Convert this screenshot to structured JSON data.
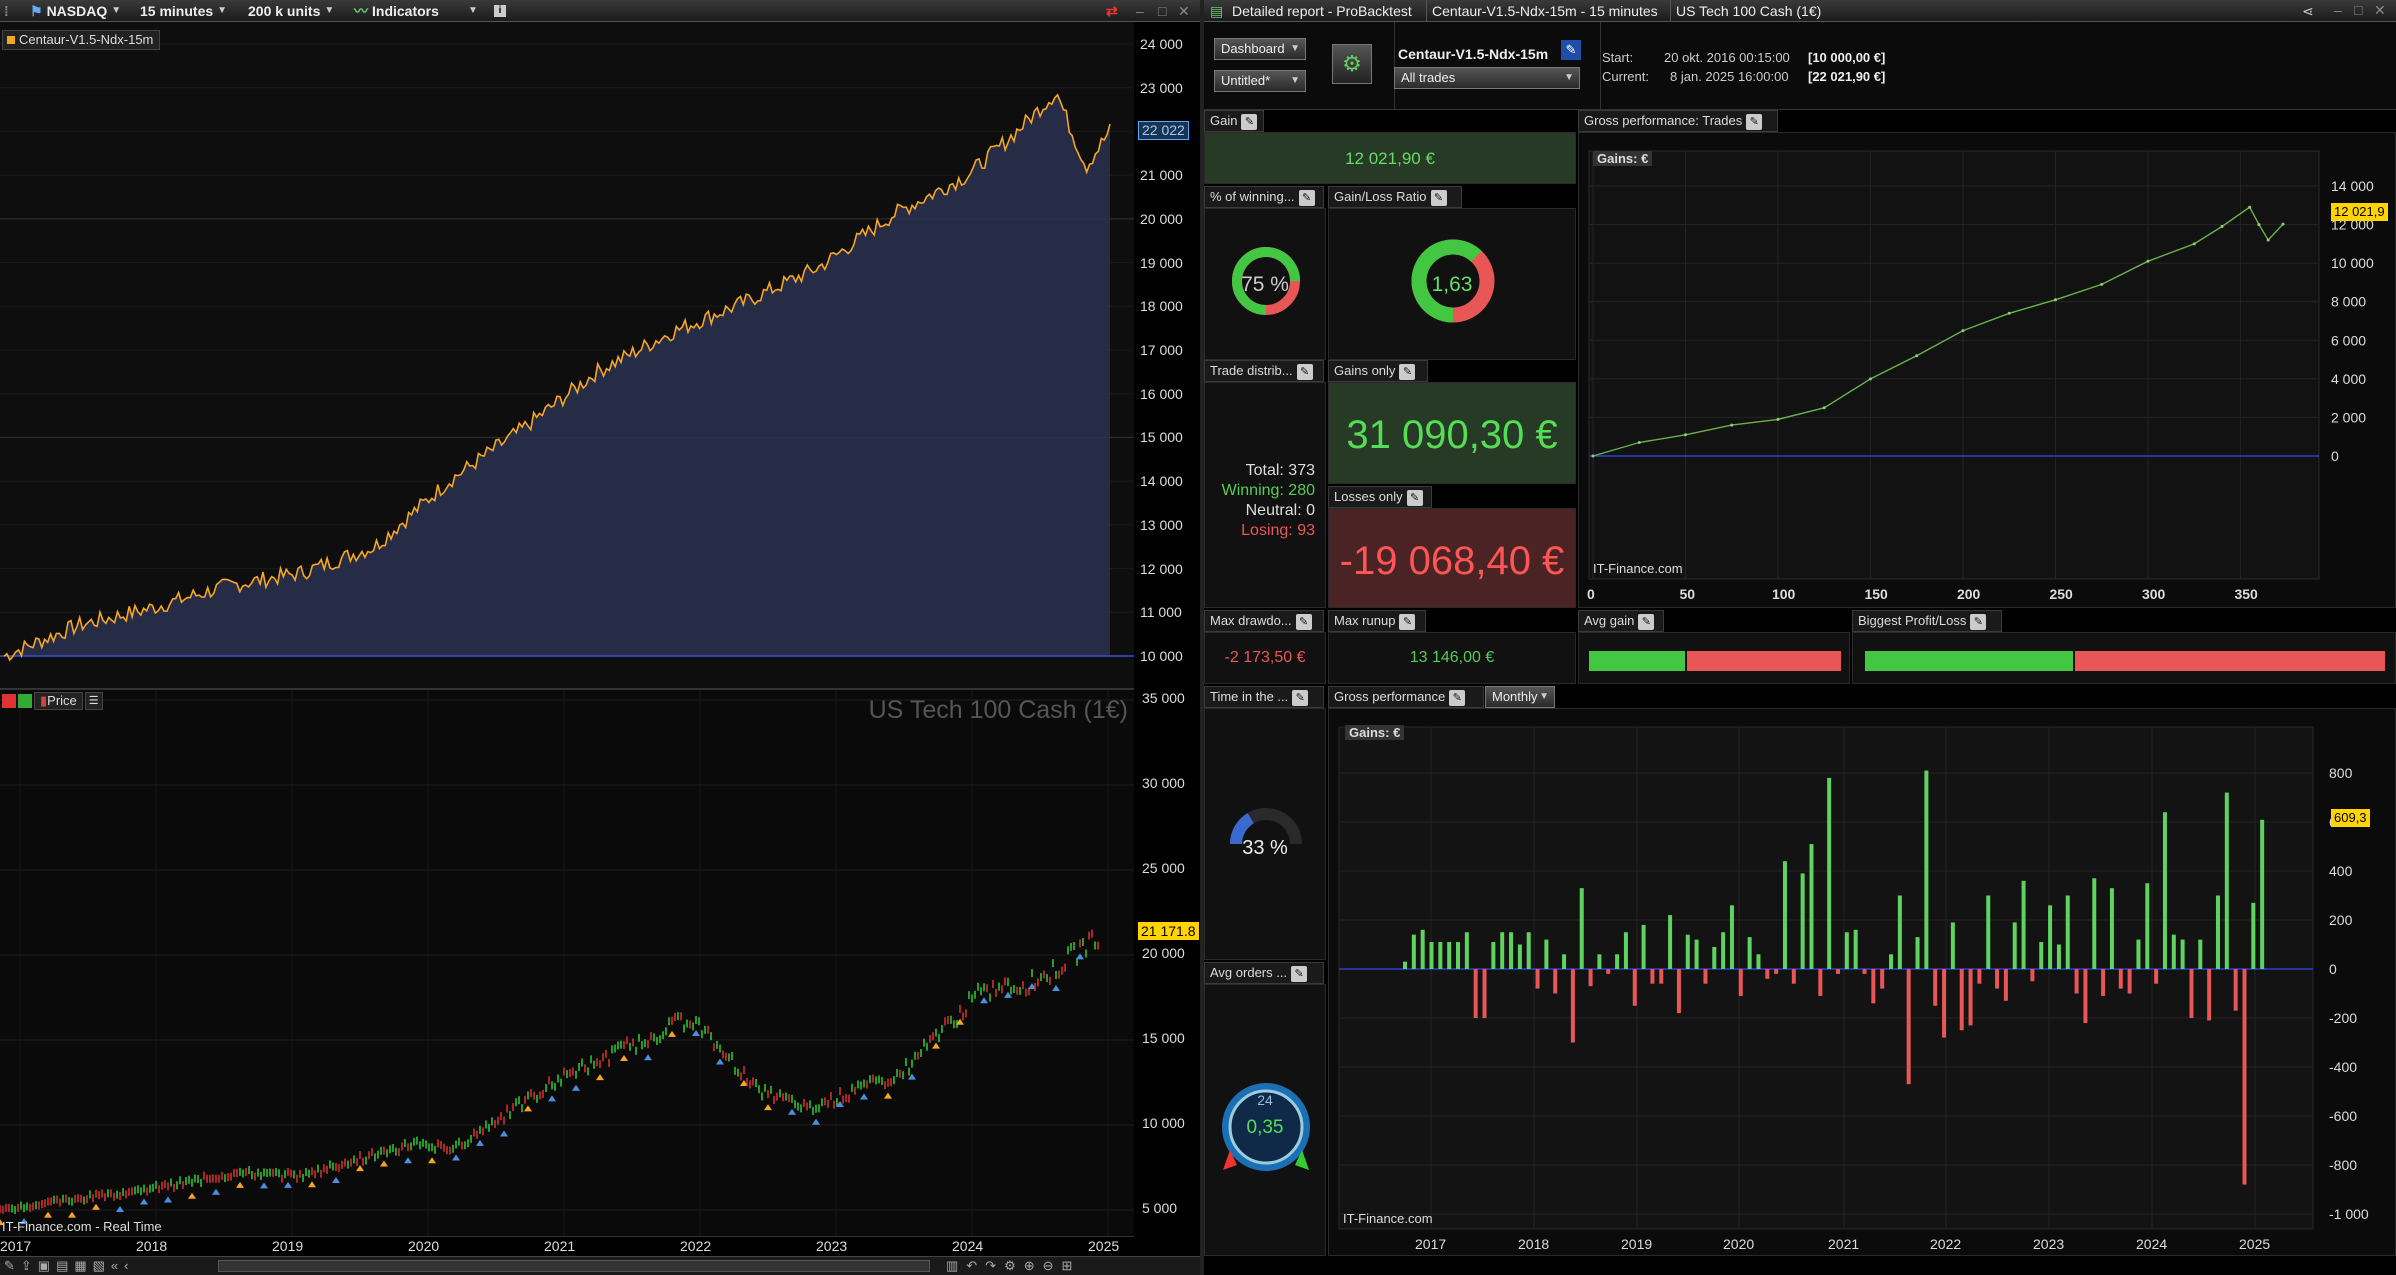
{
  "toolbar": {
    "market": "NASDAQ",
    "timeframe": "15 minutes",
    "units": "200 k units",
    "indicators": "Indicators"
  },
  "window": {
    "title": "Detailed report - ProBacktest",
    "system_tab": "Centaur-V1.5-Ndx-15m - 15 minutes",
    "instrument_tab": "US Tech 100 Cash (1€)"
  },
  "left_top": {
    "series_label": "Centaur-V1.5-Ndx-15m",
    "current_value": "22 022",
    "y_ticks": [
      "24 000",
      "23 000",
      "22 000",
      "21 000",
      "20 000",
      "19 000",
      "18 000",
      "17 000",
      "16 000",
      "15 000",
      "14 000",
      "13 000",
      "12 000",
      "11 000",
      "10 000"
    ],
    "y_values": [
      24000,
      23000,
      22000,
      21000,
      20000,
      19000,
      18000,
      17000,
      16000,
      15000,
      14000,
      13000,
      12000,
      11000,
      10000
    ]
  },
  "left_bottom": {
    "price_label": "Price",
    "watermark": "US Tech 100 Cash (1€)",
    "current_price": "21 171.8",
    "source": "IT-Finance.com - Real Time",
    "y_ticks": [
      "35 000",
      "30 000",
      "25 000",
      "20 000",
      "15 000",
      "10 000",
      "5 000"
    ],
    "y_values": [
      35000,
      30000,
      25000,
      20000,
      15000,
      10000,
      5000
    ],
    "x_ticks": [
      "2017",
      "2018",
      "2019",
      "2020",
      "2021",
      "2022",
      "2023",
      "2024",
      "2025"
    ]
  },
  "dashboard": {
    "view_select": "Dashboard",
    "untitled_select": "Untitled*",
    "system_name": "Centaur-V1.5-Ndx-15m",
    "trades_select": "All trades",
    "start_label": "Start:",
    "start_date": "20 okt. 2016 00:15:00",
    "start_value": "[10 000,00 €]",
    "current_label": "Current:",
    "current_date": "8 jan. 2025 16:00:00",
    "current_value": "[22 021,90 €]"
  },
  "gain": {
    "label": "Gain",
    "value": "12 021,90 €"
  },
  "winning": {
    "label": "% of winning...",
    "value": "75 %",
    "fraction": 0.75
  },
  "ratio": {
    "label": "Gain/Loss Ratio",
    "value": "1,63",
    "fraction": 0.62
  },
  "distribution": {
    "label": "Trade distrib...",
    "total": "Total: 373",
    "winning": "Winning: 280",
    "neutral": "Neutral: 0",
    "losing": "Losing: 93"
  },
  "gains_only": {
    "label": "Gains only",
    "value": "31 090,30 €"
  },
  "losses_only": {
    "label": "Losses only",
    "value": "-19 068,40 €"
  },
  "max_drawdown": {
    "label": "Max drawdo...",
    "value": "-2 173,50 €"
  },
  "max_runup": {
    "label": "Max runup",
    "value": "13 146,00 €"
  },
  "avg_gain": {
    "label": "Avg gain",
    "fraction": 0.38
  },
  "biggest": {
    "label": "Biggest Profit/Loss",
    "fraction": 0.4
  },
  "time_in_market": {
    "label": "Time in the ...",
    "value": "33 %",
    "fraction": 0.33
  },
  "avg_orders": {
    "label": "Avg orders ...",
    "value": "0,35",
    "badge": "24"
  },
  "gross_trades": {
    "label": "Gross performance: Trades",
    "unit": "Gains: €",
    "current": "12 021,9",
    "source": "IT-Finance.com",
    "y_ticks": [
      "14 000",
      "12 000",
      "10 000",
      "8 000",
      "6 000",
      "4 000",
      "2 000",
      "0"
    ],
    "y_values": [
      14000,
      12000,
      10000,
      8000,
      6000,
      4000,
      2000,
      0
    ],
    "x_ticks": [
      "0",
      "50",
      "100",
      "150",
      "200",
      "250",
      "300",
      "350"
    ],
    "x_values": [
      0,
      50,
      100,
      150,
      200,
      250,
      300,
      350
    ]
  },
  "gross_monthly": {
    "label": "Gross performance",
    "period_select": "Monthly",
    "unit": "Gains: €",
    "current": "609,3",
    "source": "IT-Finance.com",
    "y_ticks": [
      "800",
      "600",
      "400",
      "200",
      "0",
      "-200",
      "-400",
      "-600",
      "-800",
      "-1 000"
    ],
    "y_values": [
      800,
      600,
      400,
      200,
      0,
      -200,
      -400,
      -600,
      -800,
      -1000
    ],
    "x_ticks": [
      "2017",
      "2018",
      "2019",
      "2020",
      "2021",
      "2022",
      "2023",
      "2024",
      "2025"
    ]
  },
  "chart_data": [
    {
      "type": "bar",
      "title": "Gross performance",
      "ylabel": "Gains: €",
      "ylim": [
        -1000,
        900
      ],
      "categories": [
        "2016-11",
        "2016-12",
        "2017-01",
        "2017-02",
        "2017-03",
        "2017-04",
        "2017-05",
        "2017-06",
        "2017-07",
        "2017-08",
        "2017-09",
        "2017-10",
        "2017-11",
        "2017-12",
        "2018-01",
        "2018-02",
        "2018-03",
        "2018-04",
        "2018-05",
        "2018-06",
        "2018-07",
        "2018-08",
        "2018-09",
        "2018-10",
        "2018-11",
        "2018-12",
        "2019-01",
        "2019-02",
        "2019-03",
        "2019-04",
        "2019-05",
        "2019-06",
        "2019-07",
        "2019-08",
        "2019-09",
        "2019-10",
        "2019-11",
        "2019-12",
        "2020-01",
        "2020-02",
        "2020-03",
        "2020-04",
        "2020-05",
        "2020-06",
        "2020-07",
        "2020-08",
        "2020-09",
        "2020-10",
        "2020-11",
        "2020-12",
        "2021-01",
        "2021-02",
        "2021-03",
        "2021-04",
        "2021-05",
        "2021-06",
        "2021-07",
        "2021-08",
        "2021-09",
        "2021-10",
        "2021-11",
        "2021-12",
        "2022-01",
        "2022-02",
        "2022-03",
        "2022-04",
        "2022-05",
        "2022-06",
        "2022-07",
        "2022-08",
        "2022-09",
        "2022-10",
        "2022-11",
        "2022-12",
        "2023-01",
        "2023-02",
        "2023-03",
        "2023-04",
        "2023-05",
        "2023-06",
        "2023-07",
        "2023-08",
        "2023-09",
        "2023-10",
        "2023-11",
        "2023-12",
        "2024-01",
        "2024-02",
        "2024-03",
        "2024-04",
        "2024-05",
        "2024-06",
        "2024-07",
        "2024-08",
        "2024-09",
        "2024-10",
        "2024-11",
        "2024-12"
      ],
      "values": [
        30,
        140,
        160,
        110,
        110,
        110,
        110,
        150,
        -200,
        -200,
        110,
        150,
        150,
        100,
        150,
        -80,
        120,
        -100,
        60,
        -300,
        330,
        -70,
        60,
        -20,
        60,
        150,
        -150,
        180,
        -60,
        -60,
        220,
        -180,
        140,
        120,
        -60,
        90,
        150,
        260,
        -110,
        130,
        60,
        -40,
        -20,
        440,
        -60,
        390,
        510,
        -110,
        780,
        -20,
        150,
        160,
        -20,
        -140,
        -80,
        60,
        300,
        -470,
        130,
        810,
        -150,
        -280,
        190,
        -250,
        -230,
        -60,
        300,
        -80,
        -130,
        190,
        360,
        -50,
        110,
        260,
        100,
        300,
        -100,
        -220,
        370,
        -110,
        330,
        -80,
        -100,
        120,
        350,
        -60,
        640,
        140,
        120,
        -200,
        120,
        -210,
        300,
        720,
        -170,
        -880,
        270,
        609
      ]
    },
    {
      "type": "line",
      "title": "Gross performance: Trades",
      "ylabel": "Gains: €",
      "xlim": [
        0,
        373
      ],
      "ylim": [
        0,
        14000
      ],
      "x": [
        0,
        25,
        50,
        75,
        100,
        125,
        150,
        175,
        200,
        225,
        250,
        275,
        300,
        325,
        340,
        355,
        360,
        365,
        373
      ],
      "y": [
        0,
        700,
        1100,
        1600,
        1900,
        2500,
        4000,
        5200,
        6500,
        7400,
        8100,
        8900,
        10100,
        11000,
        11900,
        12900,
        12000,
        11200,
        12021.9
      ]
    }
  ]
}
